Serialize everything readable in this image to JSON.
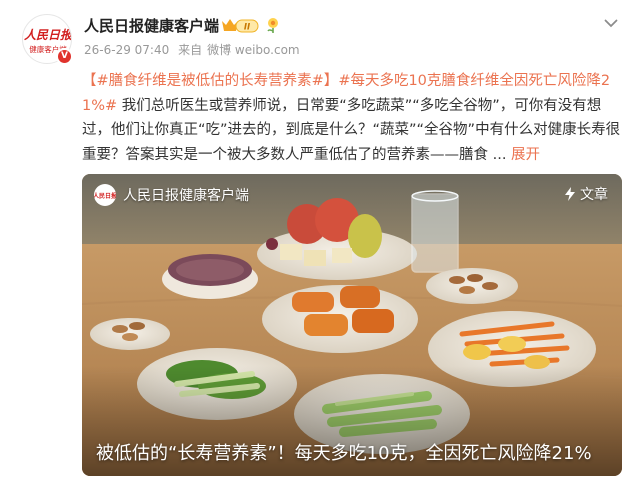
{
  "post": {
    "author": "人民日报健康客户端",
    "avatar_logo_text": "人民日报",
    "avatar_sub_text": "健康客户端",
    "level_badge": "II",
    "time": "26-6-29 07:40",
    "source_prefix": "来自",
    "source": "微博 weibo.com",
    "content": {
      "hashtag1": "【#膳食纤维是被低估的长寿营养素#】",
      "hashtag2": "#每天多吃10克膳食纤维全因死亡风险降21%#",
      "body": " 我们总听医生或营养师说，日常要“多吃蔬菜”“多吃全谷物”，可你有没有想过，他们让你真正“吃”进去的，到底是什么？“蔬菜”“全谷物”中有什么对健康长寿很重要？答案其实是一个被大多数人严重低估了的营养素——膳食 ...",
      "expand": "展开"
    },
    "card": {
      "source_name": "人民日报健康客户端",
      "type_label": "文章",
      "caption": "被低估的“长寿营养素”！每天多吃10克，全因死亡风险降21%"
    }
  },
  "colors": {
    "hashtag": "#eb7350",
    "author": "#222222",
    "meta": "#999999",
    "vip": "#e0332d"
  }
}
